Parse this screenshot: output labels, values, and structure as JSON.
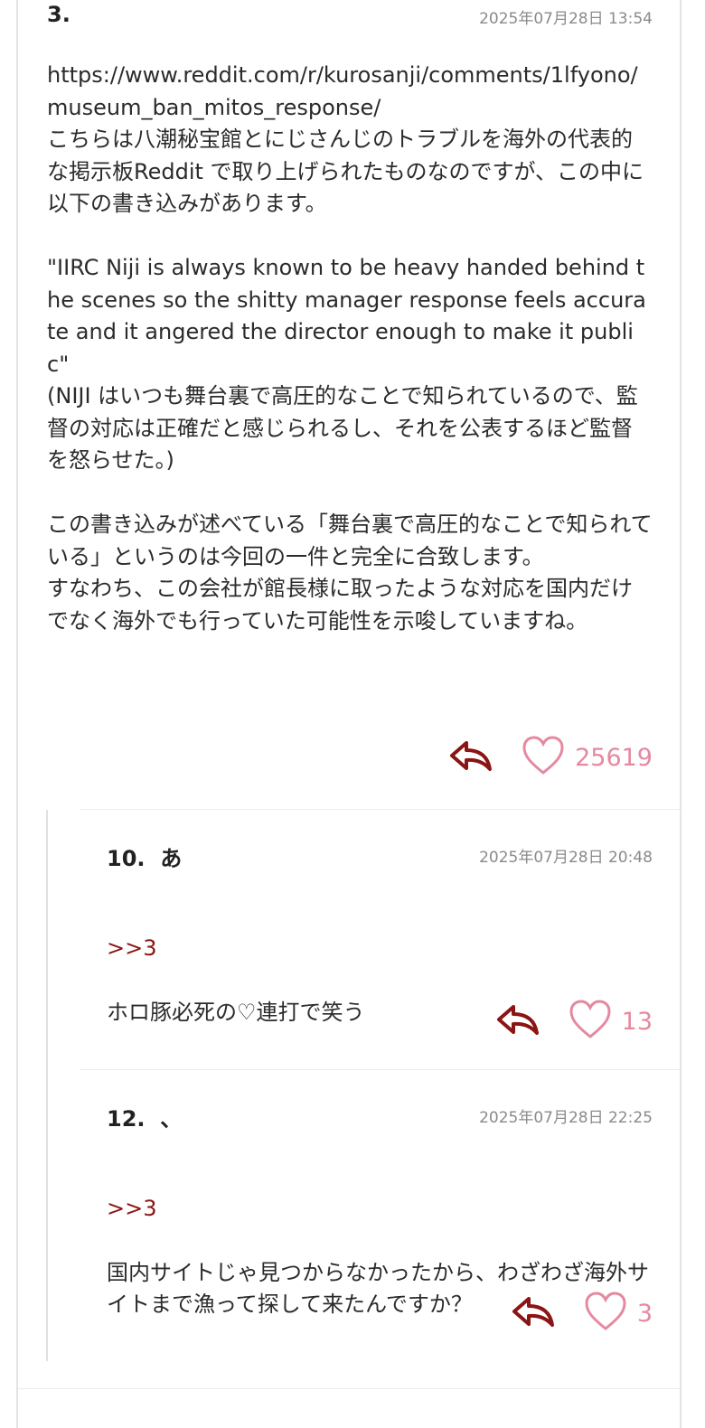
{
  "posts": [
    {
      "number": "3.",
      "date": "2025年07月28日 13:54",
      "body": "https://www.reddit.com/r/kurosanji/comments/1lfyono/museum_ban_mitos_response/\nこちらは八潮秘宝館とにじさんじのトラブルを海外の代表的な掲示板Reddit で取り上げられたものなのですが、この中に以下の書き込みがあります。\n\n\"IIRC Niji is always known to be heavy handed behind the scenes so the shitty manager response feels accurate and it angered the director enough to make it public\"\n(NIJI はいつも舞台裏で高圧的なことで知られているので、監督の対応は正確だと感じられるし、それを公表するほど監督を怒らせた。)\n\nこの書き込みが述べている「舞台裏で高圧的なことで知られている」というのは今回の一件と完全に合致します。\nすなわち、この会社が館長様に取ったような対応を国内だけでなく海外でも行っていた可能性を示唆していますね。",
      "likes": "25619"
    },
    {
      "number": "10.",
      "author": "あ",
      "date": "2025年07月28日 20:48",
      "anchor": ">>3",
      "body": "ホロ豚必死の♡連打で笑う",
      "likes": "13"
    },
    {
      "number": "12.",
      "author": "、",
      "date": "2025年07月28日 22:25",
      "anchor": ">>3",
      "body": "国内サイトじゃ見つからなかったから、わざわざ海外サイトまで漁って探して来たんですか？",
      "likes": "3"
    }
  ],
  "colors": {
    "reply_icon": "#8b1414",
    "heart": "#e5899f",
    "anchor": "#8b1414"
  },
  "icons": {
    "reply": "reply-arrow-icon",
    "like": "heart-icon"
  }
}
